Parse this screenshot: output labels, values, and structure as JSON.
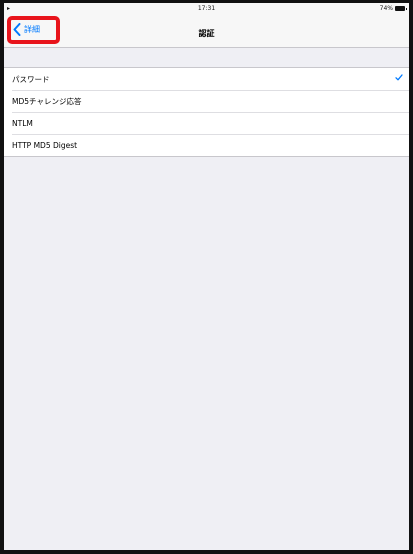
{
  "status_bar": {
    "time": "17:31",
    "battery": "74%"
  },
  "nav": {
    "back_label": "詳細",
    "title": "認証"
  },
  "options": [
    {
      "label": "パスワード",
      "selected": true
    },
    {
      "label": "MD5チャレンジ応答",
      "selected": false
    },
    {
      "label": "NTLM",
      "selected": false
    },
    {
      "label": "HTTP MD5 Digest",
      "selected": false
    }
  ],
  "colors": {
    "accent": "#007aff",
    "highlight": "#e8141b",
    "background": "#efeff4"
  }
}
